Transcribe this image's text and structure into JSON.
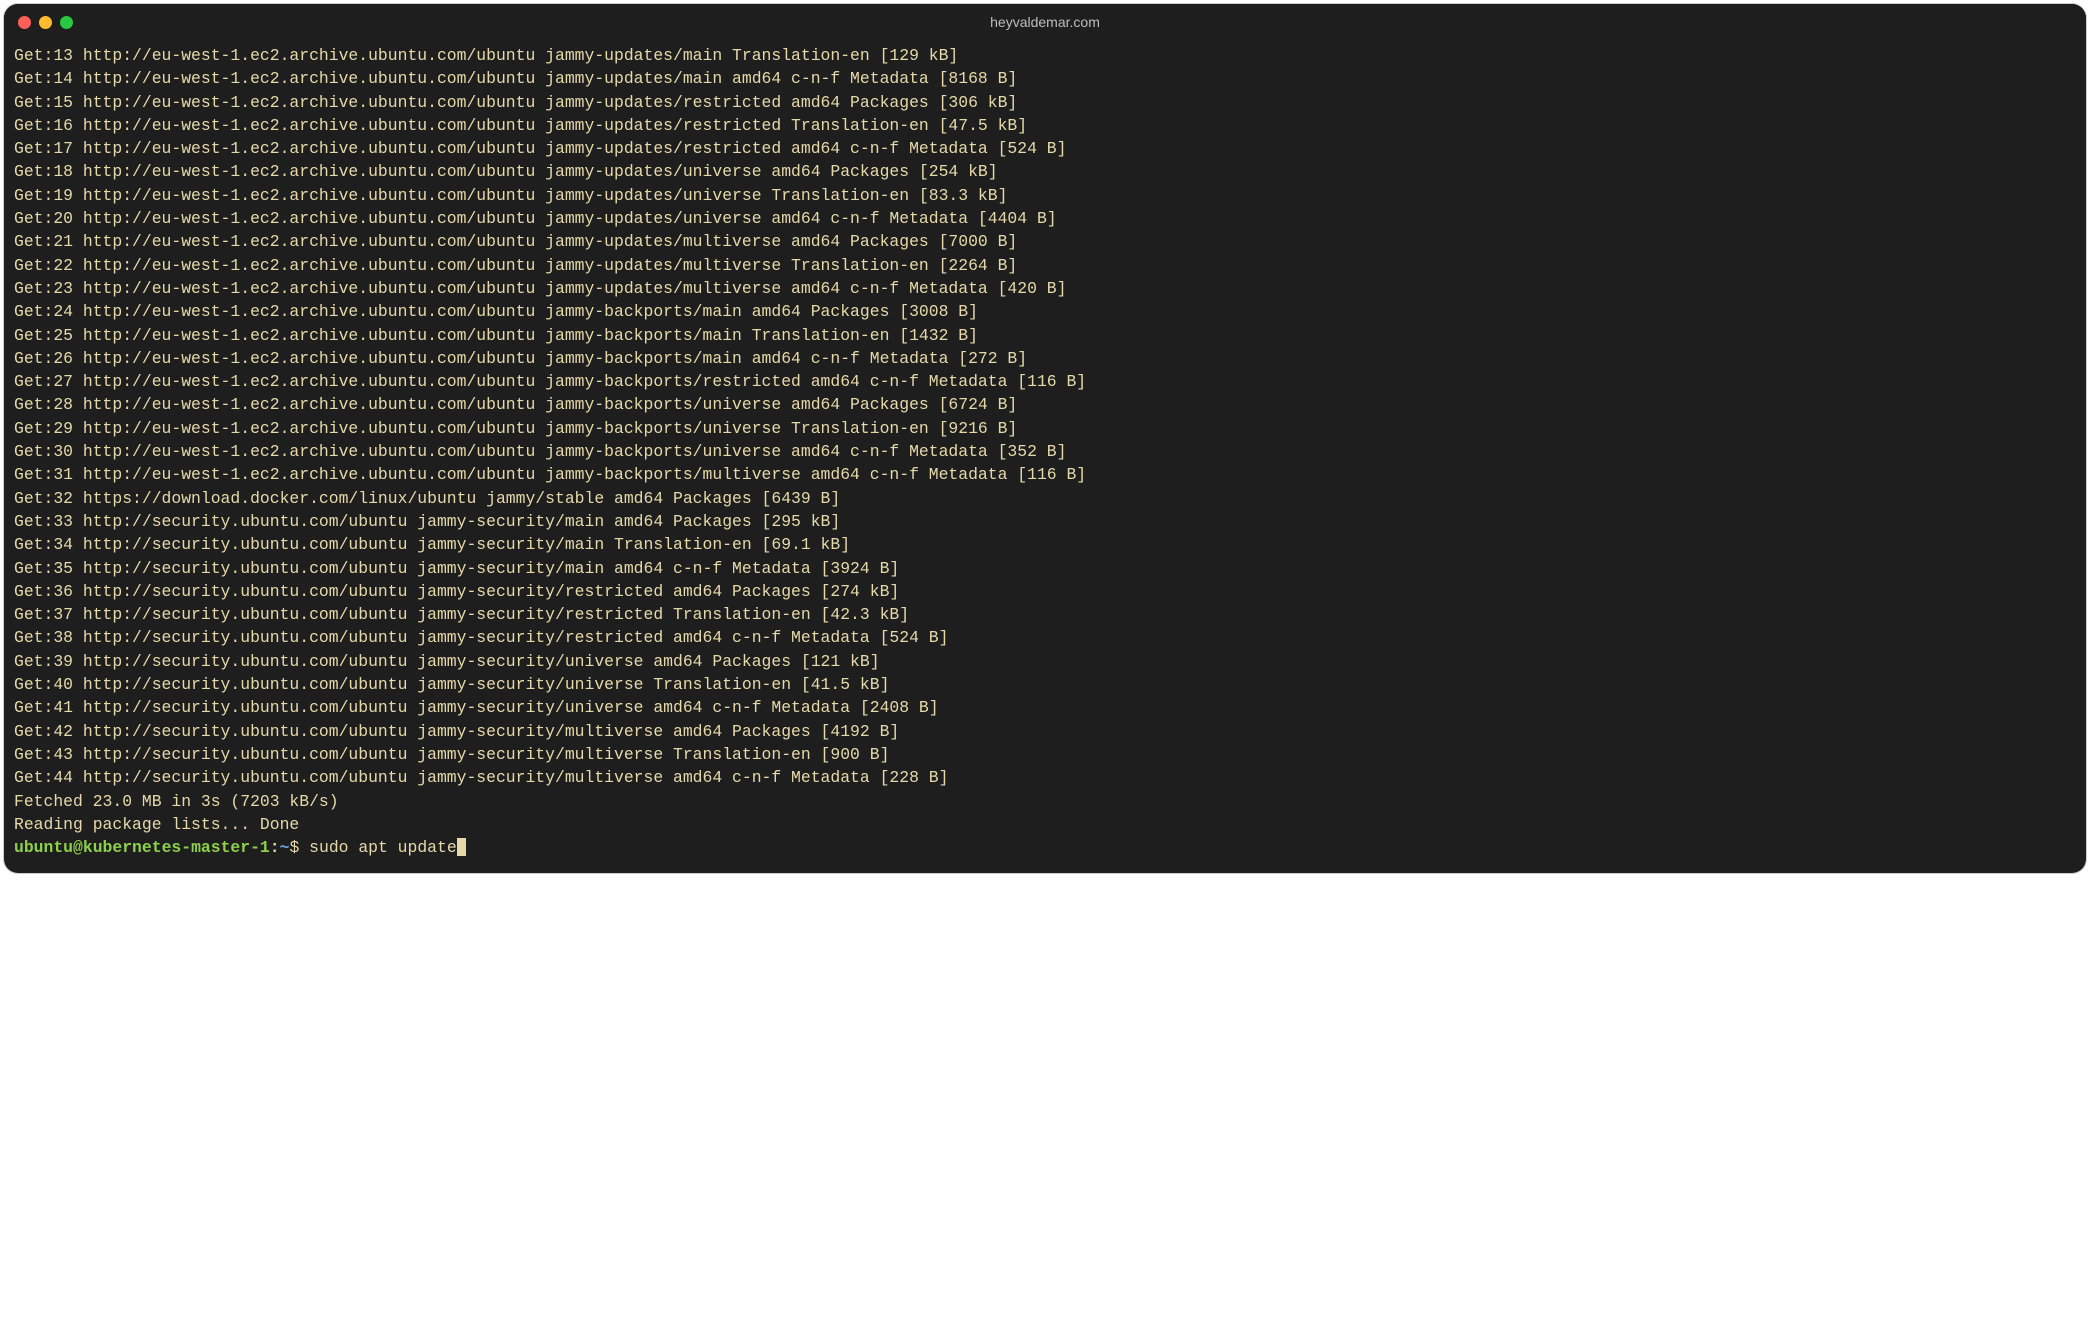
{
  "window": {
    "title": "heyvaldemar.com"
  },
  "output_lines": [
    "Get:13 http://eu-west-1.ec2.archive.ubuntu.com/ubuntu jammy-updates/main Translation-en [129 kB]",
    "Get:14 http://eu-west-1.ec2.archive.ubuntu.com/ubuntu jammy-updates/main amd64 c-n-f Metadata [8168 B]",
    "Get:15 http://eu-west-1.ec2.archive.ubuntu.com/ubuntu jammy-updates/restricted amd64 Packages [306 kB]",
    "Get:16 http://eu-west-1.ec2.archive.ubuntu.com/ubuntu jammy-updates/restricted Translation-en [47.5 kB]",
    "Get:17 http://eu-west-1.ec2.archive.ubuntu.com/ubuntu jammy-updates/restricted amd64 c-n-f Metadata [524 B]",
    "Get:18 http://eu-west-1.ec2.archive.ubuntu.com/ubuntu jammy-updates/universe amd64 Packages [254 kB]",
    "Get:19 http://eu-west-1.ec2.archive.ubuntu.com/ubuntu jammy-updates/universe Translation-en [83.3 kB]",
    "Get:20 http://eu-west-1.ec2.archive.ubuntu.com/ubuntu jammy-updates/universe amd64 c-n-f Metadata [4404 B]",
    "Get:21 http://eu-west-1.ec2.archive.ubuntu.com/ubuntu jammy-updates/multiverse amd64 Packages [7000 B]",
    "Get:22 http://eu-west-1.ec2.archive.ubuntu.com/ubuntu jammy-updates/multiverse Translation-en [2264 B]",
    "Get:23 http://eu-west-1.ec2.archive.ubuntu.com/ubuntu jammy-updates/multiverse amd64 c-n-f Metadata [420 B]",
    "Get:24 http://eu-west-1.ec2.archive.ubuntu.com/ubuntu jammy-backports/main amd64 Packages [3008 B]",
    "Get:25 http://eu-west-1.ec2.archive.ubuntu.com/ubuntu jammy-backports/main Translation-en [1432 B]",
    "Get:26 http://eu-west-1.ec2.archive.ubuntu.com/ubuntu jammy-backports/main amd64 c-n-f Metadata [272 B]",
    "Get:27 http://eu-west-1.ec2.archive.ubuntu.com/ubuntu jammy-backports/restricted amd64 c-n-f Metadata [116 B]",
    "Get:28 http://eu-west-1.ec2.archive.ubuntu.com/ubuntu jammy-backports/universe amd64 Packages [6724 B]",
    "Get:29 http://eu-west-1.ec2.archive.ubuntu.com/ubuntu jammy-backports/universe Translation-en [9216 B]",
    "Get:30 http://eu-west-1.ec2.archive.ubuntu.com/ubuntu jammy-backports/universe amd64 c-n-f Metadata [352 B]",
    "Get:31 http://eu-west-1.ec2.archive.ubuntu.com/ubuntu jammy-backports/multiverse amd64 c-n-f Metadata [116 B]",
    "Get:32 https://download.docker.com/linux/ubuntu jammy/stable amd64 Packages [6439 B]",
    "Get:33 http://security.ubuntu.com/ubuntu jammy-security/main amd64 Packages [295 kB]",
    "Get:34 http://security.ubuntu.com/ubuntu jammy-security/main Translation-en [69.1 kB]",
    "Get:35 http://security.ubuntu.com/ubuntu jammy-security/main amd64 c-n-f Metadata [3924 B]",
    "Get:36 http://security.ubuntu.com/ubuntu jammy-security/restricted amd64 Packages [274 kB]",
    "Get:37 http://security.ubuntu.com/ubuntu jammy-security/restricted Translation-en [42.3 kB]",
    "Get:38 http://security.ubuntu.com/ubuntu jammy-security/restricted amd64 c-n-f Metadata [524 B]",
    "Get:39 http://security.ubuntu.com/ubuntu jammy-security/universe amd64 Packages [121 kB]",
    "Get:40 http://security.ubuntu.com/ubuntu jammy-security/universe Translation-en [41.5 kB]",
    "Get:41 http://security.ubuntu.com/ubuntu jammy-security/universe amd64 c-n-f Metadata [2408 B]",
    "Get:42 http://security.ubuntu.com/ubuntu jammy-security/multiverse amd64 Packages [4192 B]",
    "Get:43 http://security.ubuntu.com/ubuntu jammy-security/multiverse Translation-en [900 B]",
    "Get:44 http://security.ubuntu.com/ubuntu jammy-security/multiverse amd64 c-n-f Metadata [228 B]",
    "Fetched 23.0 MB in 3s (7203 kB/s)",
    "Reading package lists... Done"
  ],
  "prompt": {
    "user": "ubuntu",
    "at": "@",
    "host": "kubernetes-master-1",
    "colon": ":",
    "path": "~",
    "dollar": "$ ",
    "command": "sudo apt update"
  }
}
